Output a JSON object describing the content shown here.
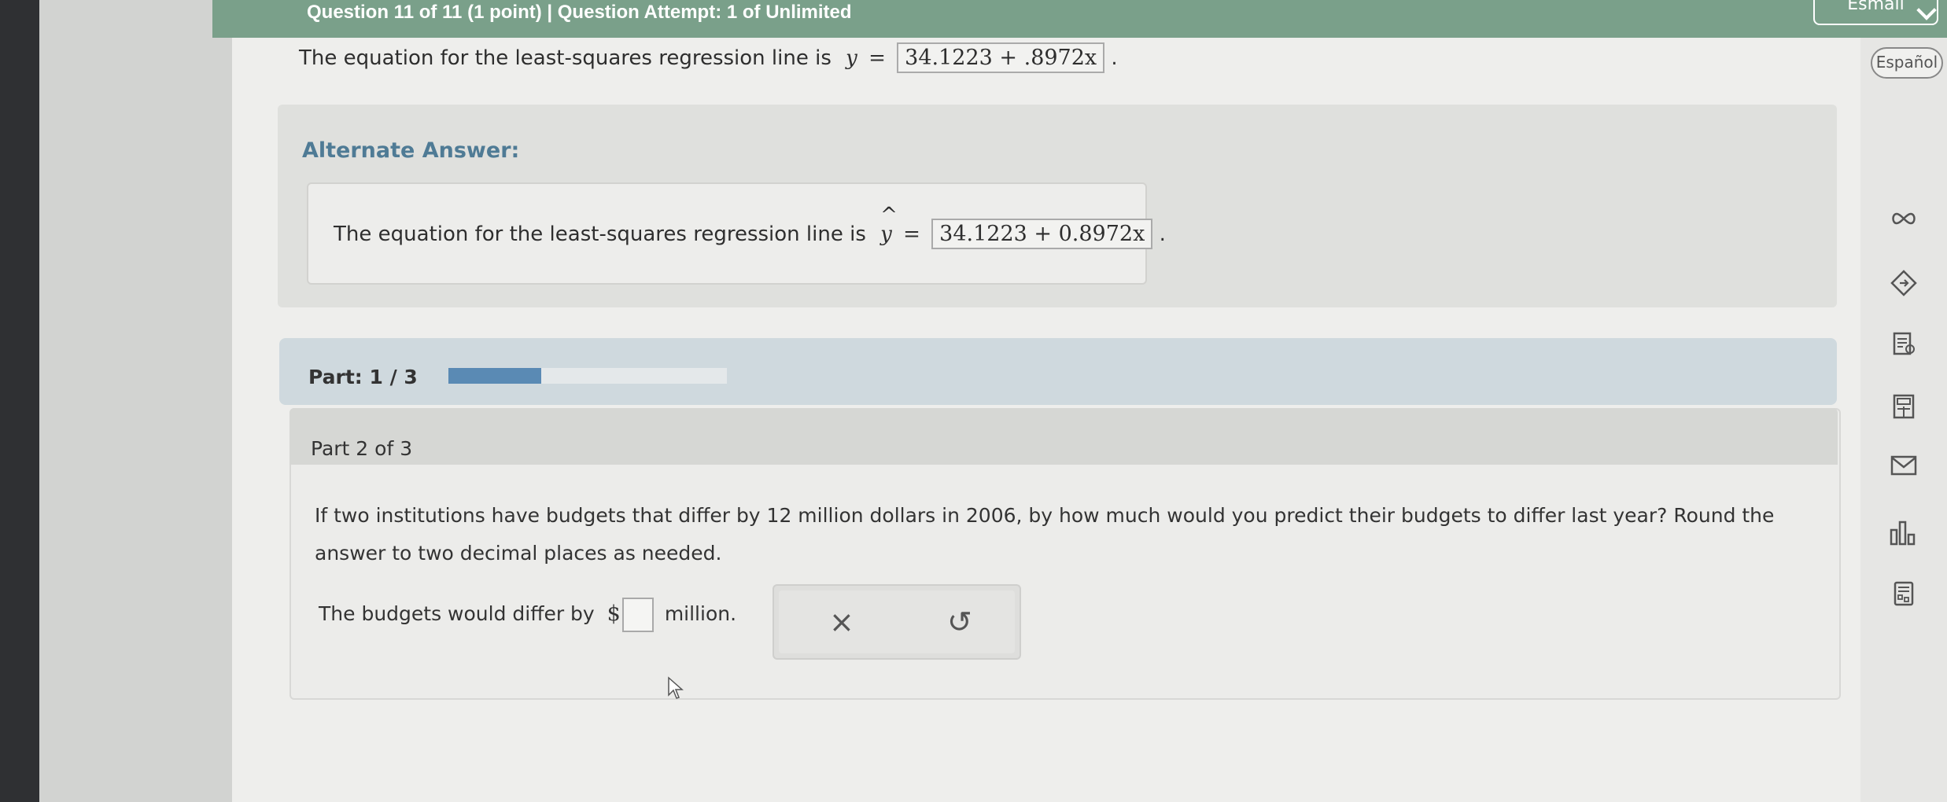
{
  "header": {
    "title": "Question 11 of 11 (1 point)  |  Question Attempt: 1 of Unlimited",
    "right_button": "Esmail"
  },
  "language_button": "Español",
  "previous_answer": {
    "prefix": "The equation for the least-squares regression line is",
    "var": "y",
    "equals": "=",
    "answer": "34.1223 + .8972x",
    "suffix": "."
  },
  "alternate": {
    "title": "Alternate Answer:",
    "prefix": "The equation for the least-squares regression line is",
    "var": "y",
    "equals": "=",
    "answer": "34.1223 + 0.8972x",
    "suffix": "."
  },
  "part_progress": {
    "label": "Part: 1 / 3",
    "fraction": 0.333
  },
  "question": {
    "header": "Part 2 of 3",
    "text": "If two institutions have budgets that differ by 12 million dollars in 2006, by how much would you predict their budgets to differ last year? Round the answer to two decimal places as needed.",
    "answer_prefix": "The budgets would differ by",
    "currency": "$",
    "answer_suffix": "million."
  },
  "tools": {
    "clear": "×",
    "undo": "↺"
  },
  "sidebar_icons": [
    "infinity-icon",
    "tag-icon",
    "notes-icon",
    "calculator-icon",
    "mail-icon",
    "chart-icon",
    "datasheet-icon"
  ]
}
